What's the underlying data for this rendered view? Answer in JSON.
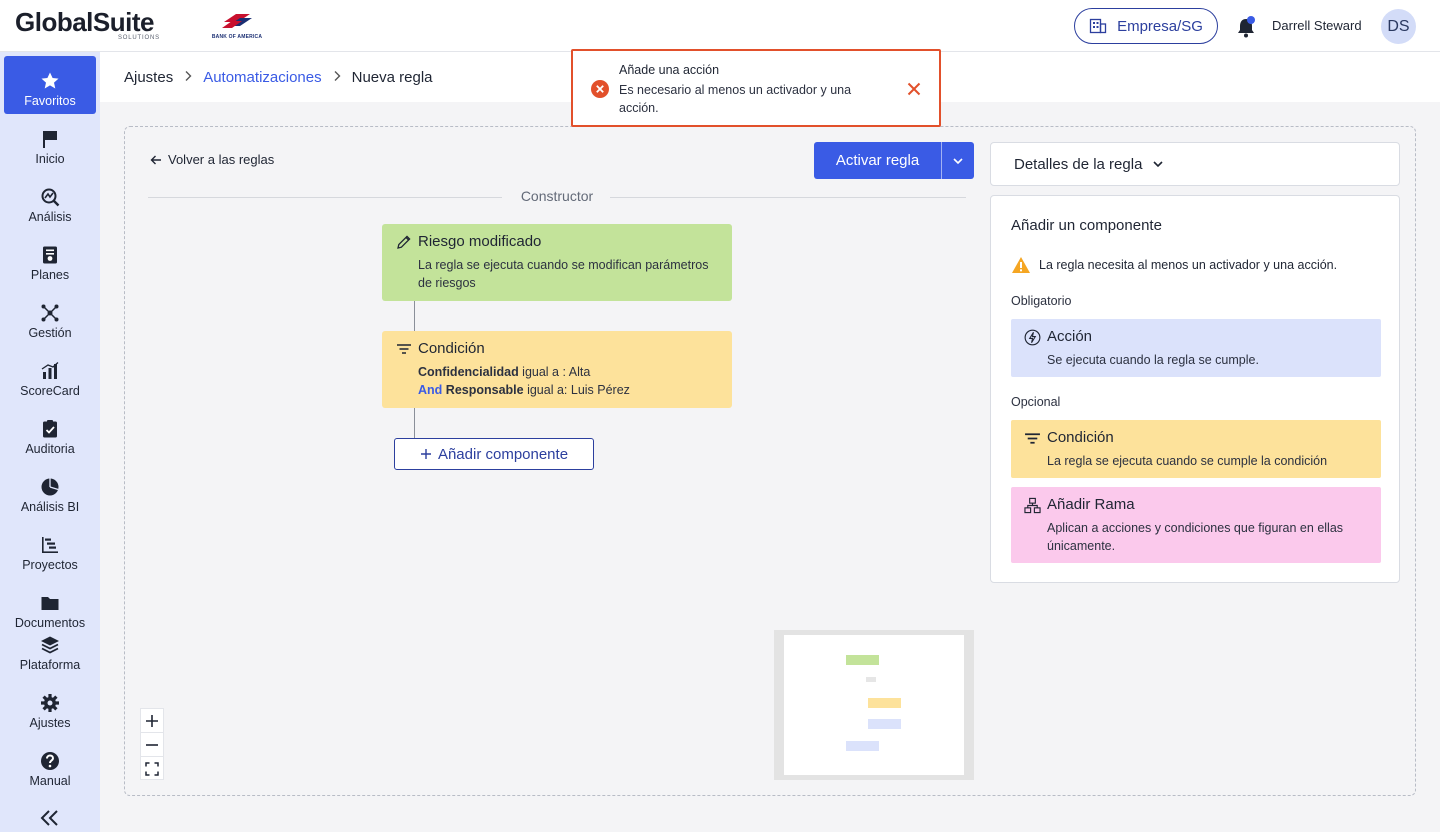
{
  "header": {
    "brand": "GlobalSuite",
    "brand_sub": "SOLUTIONS",
    "partner": "BANK OF AMERICA",
    "company_button": "Empresa/SG",
    "user_name": "Darrell Steward",
    "user_initials": "DS"
  },
  "sidebar": {
    "items": [
      {
        "label": "Favoritos",
        "icon": "star-icon"
      },
      {
        "label": "Inicio",
        "icon": "flag-icon"
      },
      {
        "label": "Análisis",
        "icon": "analysis-icon"
      },
      {
        "label": "Planes",
        "icon": "plans-icon"
      },
      {
        "label": "Gestión",
        "icon": "network-icon"
      },
      {
        "label": "ScoreCard",
        "icon": "bar-chart-icon"
      },
      {
        "label": "Auditoria",
        "icon": "clipboard-check-icon"
      },
      {
        "label": "Análisis BI",
        "icon": "pie-chart-icon"
      },
      {
        "label": "Proyectos",
        "icon": "gantt-icon"
      },
      {
        "label": "Documentos",
        "icon": "folder-icon"
      },
      {
        "label": "Plataforma",
        "icon": "layers-icon"
      },
      {
        "label": "Ajustes",
        "icon": "gear-icon"
      },
      {
        "label": "Manual",
        "icon": "help-icon"
      }
    ]
  },
  "breadcrumb": {
    "root": "Ajustes",
    "parent": "Automatizaciones",
    "current": "Nueva regla"
  },
  "toast": {
    "title": "Añade una acción",
    "message": "Es necesario al menos un activador y una acción."
  },
  "builder": {
    "back_label": "Volver a las reglas",
    "activate_label": "Activar regla",
    "section_label": "Constructor",
    "trigger": {
      "title": "Riesgo modificado",
      "description": "La regla se ejecuta cuando se modifican parámetros de riesgos"
    },
    "condition": {
      "title": "Condición",
      "line1_field": "Confidencialidad",
      "line1_rest": " igual a : Alta",
      "line2_op": "And",
      "line2_field": "Responsable",
      "line2_rest": " igual a: Luis Pérez"
    },
    "add_component": "Añadir componente"
  },
  "panel": {
    "details_label": "Detalles de la regla",
    "add_title": "Añadir un componente",
    "warning": "La regla necesita al menos un activador y una acción.",
    "required_label": "Obligatorio",
    "optional_label": "Opcional",
    "components": {
      "action": {
        "title": "Acción",
        "description": "Se ejecuta cuando la regla se cumple."
      },
      "condition": {
        "title": "Condición",
        "description": "La regla se ejecuta cuando se cumple la condición"
      },
      "branch": {
        "title": "Añadir Rama",
        "description": "Aplican a acciones y condiciones que figuran en ellas únicamente."
      }
    }
  },
  "colors": {
    "primary": "#3a5be5",
    "trigger": "#c3e39a",
    "condition": "#fde29b",
    "action": "#dbe2fb",
    "branch": "#fbc9ec",
    "error": "#e2502b"
  }
}
